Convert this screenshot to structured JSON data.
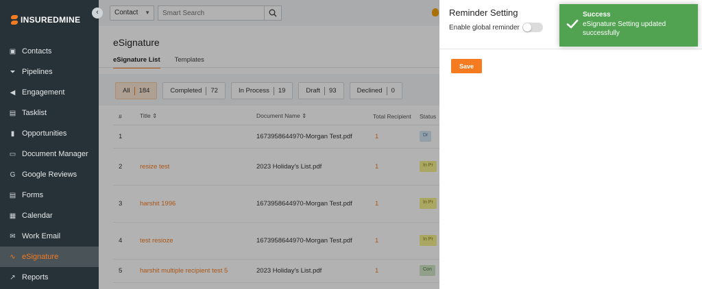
{
  "app": {
    "logo_bold": "INSUREDMINE",
    "collapse_glyph": "‹"
  },
  "sidebar": {
    "items": [
      {
        "label": "Contacts",
        "icon": "contacts-icon"
      },
      {
        "label": "Pipelines",
        "icon": "funnel-icon"
      },
      {
        "label": "Engagement",
        "icon": "megaphone-icon"
      },
      {
        "label": "Tasklist",
        "icon": "tasklist-icon"
      },
      {
        "label": "Opportunities",
        "icon": "bar-chart-icon"
      },
      {
        "label": "Document Manager",
        "icon": "folder-icon"
      },
      {
        "label": "Google Reviews",
        "icon": "google-icon"
      },
      {
        "label": "Forms",
        "icon": "form-icon"
      },
      {
        "label": "Calendar",
        "icon": "calendar-icon"
      },
      {
        "label": "Work Email",
        "icon": "mail-icon"
      },
      {
        "label": "eSignature",
        "icon": "signature-icon",
        "active": true
      },
      {
        "label": "Reports",
        "icon": "line-chart-icon"
      }
    ]
  },
  "search": {
    "type_value": "Contact",
    "placeholder": "Smart Search"
  },
  "page": {
    "title": "eSignature",
    "tabs": [
      "eSignature List",
      "Templates"
    ],
    "filters": [
      {
        "label": "All",
        "count": "184",
        "active": true
      },
      {
        "label": "Completed",
        "count": "72"
      },
      {
        "label": "In Process",
        "count": "19"
      },
      {
        "label": "Draft",
        "count": "93"
      },
      {
        "label": "Declined",
        "count": "0"
      }
    ]
  },
  "table": {
    "headers": [
      "#",
      "Title",
      "Document Name",
      "Total Recipient",
      "Status"
    ],
    "rows": [
      {
        "num": "1",
        "title": "",
        "document": "1673958644970-Morgan Test.pdf",
        "recipients": "1",
        "status": "Dr",
        "status_type": "draft"
      },
      {
        "num": "2",
        "title": "resize test",
        "document": "2023 Holiday's List.pdf",
        "recipients": "1",
        "status": "In Pr",
        "status_type": "inprocess"
      },
      {
        "num": "3",
        "title": "harshit 1996",
        "document": "1673958644970-Morgan Test.pdf",
        "recipients": "1",
        "status": "In Pr",
        "status_type": "inprocess"
      },
      {
        "num": "4",
        "title": "test resioze",
        "document": "1673958644970-Morgan Test.pdf",
        "recipients": "1",
        "status": "In Pr",
        "status_type": "inprocess"
      },
      {
        "num": "5",
        "title": "harshit multiple recipient test 5",
        "document": "2023 Holiday's List.pdf",
        "recipients": "1",
        "status": "Con",
        "status_type": "completed"
      }
    ]
  },
  "panel": {
    "title": "Reminder Setting",
    "toggle_label": "Enable global reminder",
    "toggle_on": false,
    "save_label": "Save"
  },
  "toast": {
    "title": "Success",
    "message": "eSignature Setting updated successfully",
    "color": "#51a351"
  },
  "colors": {
    "accent": "#f47b20",
    "sidebar": "#263238"
  }
}
